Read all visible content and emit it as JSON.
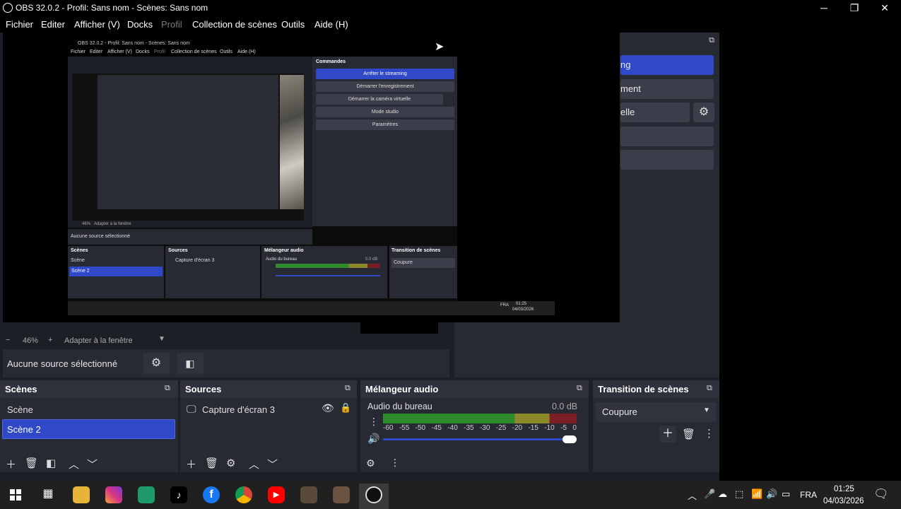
{
  "window": {
    "title": "OBS 32.0.2 - Profil: Sans nom - Scènes: Sans nom",
    "minimize": "─",
    "maximize": "❐",
    "close": "✕"
  },
  "menu": [
    "Fichier",
    "Editer",
    "Afficher (V)",
    "Docks",
    "Profil",
    "Collection de scènes",
    "Outils",
    "Aide (H)"
  ],
  "inner_obs": {
    "title": "OBS 32.0.2 - Profil: Sans nom - Scènes: Sans nom",
    "menu": [
      "Fichier",
      "Editer",
      "Afficher (V)",
      "Docks",
      "Profil",
      "Collection de scènes",
      "Outils",
      "Aide (H)"
    ],
    "commands_title": "Commandes",
    "commands": [
      "Arrêter le streaming",
      "Démarrer l'enregistrement",
      "Démarrer la caméra virtuelle",
      "Mode studio",
      "Paramètres"
    ],
    "zoom": "46%",
    "fit": "Adapter à la fenêtre",
    "no_source": "Aucune source sélectionné",
    "scenes_title": "Scènes",
    "scenes": [
      "Scène",
      "Scène 2"
    ],
    "sources_title": "Sources",
    "source": "Capture d'écran 3",
    "mixer_title": "Mélangeur audio",
    "audio": "Audio du bureau",
    "db": "0.0 dB",
    "transition_title": "Transition de scènes",
    "transition": "Coupure",
    "time": "01:25",
    "date": "04/03/2026",
    "lang": "FRA"
  },
  "commands_partial": [
    "ng",
    "ment",
    "elle",
    "",
    ""
  ],
  "zoom": {
    "minus": "−",
    "value": "46%",
    "plus": "+",
    "fit": "Adapter à la fenêtre"
  },
  "source_bar": {
    "none": "Aucune source sélectionné"
  },
  "scenes": {
    "title": "Scènes",
    "items": [
      "Scène",
      "Scène 2"
    ],
    "selected": 1
  },
  "sources": {
    "title": "Sources",
    "items": [
      {
        "name": "Capture d'écran 3"
      }
    ]
  },
  "mixer": {
    "title": "Mélangeur audio",
    "channel": "Audio du bureau",
    "db": "0.0 dB",
    "ticks": [
      "-60",
      "-55",
      "-50",
      "-45",
      "-40",
      "-35",
      "-30",
      "-25",
      "-20",
      "-15",
      "-10",
      "-5",
      "0"
    ],
    "volume_fraction": 1.0
  },
  "transition": {
    "title": "Transition de scènes",
    "value": "Coupure"
  },
  "taskbar": {
    "lang": "FRA",
    "time": "01:25",
    "date": "04/03/2026"
  },
  "colors": {
    "accent": "#2f49c8",
    "panel": "#272a33",
    "bg": "#1d1f26",
    "meter_green": "#2d8a2d",
    "meter_yellow": "#8a8a2a",
    "meter_red": "#7a1e28"
  }
}
